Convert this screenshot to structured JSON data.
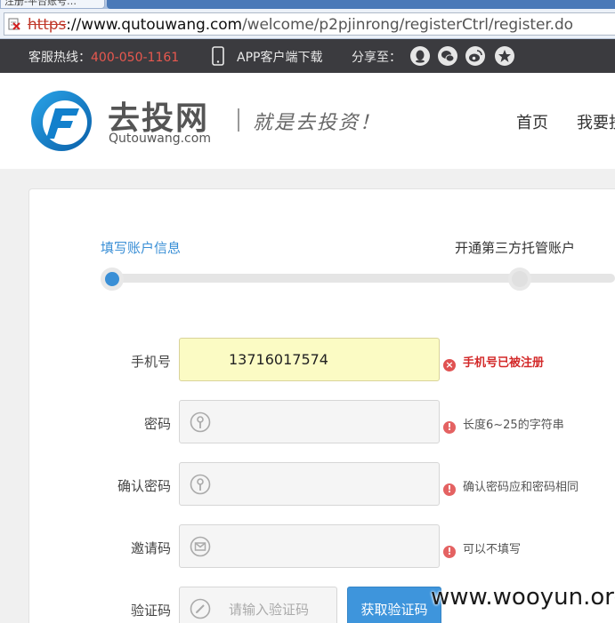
{
  "browser": {
    "tab_title": "注册-平台账号…",
    "url_scheme": "https",
    "url_domain": "://www.qutouwang.com",
    "url_path": "/welcome/p2pjinrong/registerCtrl/register.do"
  },
  "topbar": {
    "hotline_label": "客服热线：",
    "hotline_number": "400-050-1161",
    "app_download": "APP客户端下载",
    "share_label": "分享至：",
    "share_icons": [
      "qq-icon",
      "wechat-icon",
      "weibo-icon",
      "qzone-icon"
    ]
  },
  "header": {
    "logo_cn": "去投网",
    "logo_en": "Qutouwang.com",
    "slogan": "就是去投资！",
    "nav": [
      "首页",
      "我要投"
    ]
  },
  "steps": {
    "items": [
      "填写账户信息",
      "开通第三方托管账户"
    ],
    "current_index": 0
  },
  "form": {
    "phone": {
      "label": "手机号",
      "value": "13716017574",
      "hint": "手机号已被注册",
      "hint_type": "error"
    },
    "password": {
      "label": "密码",
      "value": "",
      "hint": "长度6~25的字符串",
      "hint_type": "info"
    },
    "confirm_password": {
      "label": "确认密码",
      "value": "",
      "hint": "确认密码应和密码相同",
      "hint_type": "info"
    },
    "invite_code": {
      "label": "邀请码",
      "value": "",
      "hint": "可以不填写",
      "hint_type": "info"
    },
    "captcha": {
      "label": "验证码",
      "placeholder": "请输入验证码",
      "button": "获取验证码"
    }
  },
  "colors": {
    "accent": "#3a8fd6",
    "error": "#d32a2a",
    "topbar_bg": "#3b3b3f",
    "hotline": "#e8584f"
  },
  "watermark": "www.wooyun.org"
}
